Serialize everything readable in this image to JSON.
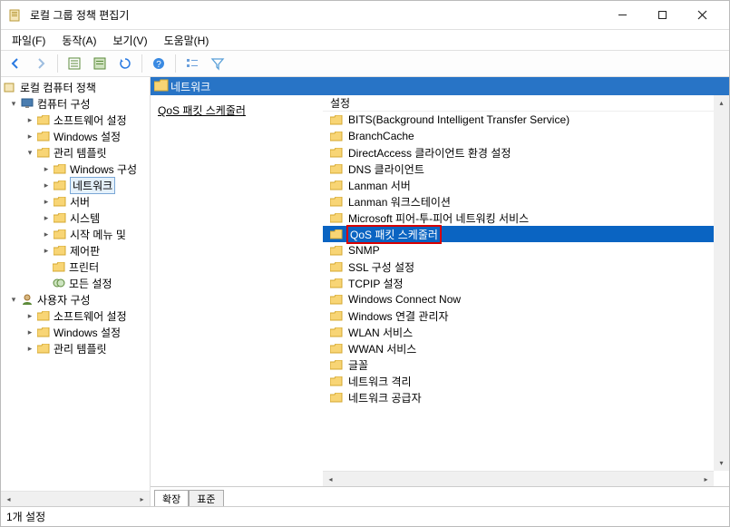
{
  "window": {
    "title": "로컬 그룹 정책 편집기"
  },
  "menu": {
    "file": "파일(F)",
    "action": "동작(A)",
    "view": "보기(V)",
    "help": "도움말(H)"
  },
  "toolbar_icons": {
    "back": "back-arrow",
    "forward": "forward-arrow",
    "properties": "properties",
    "details": "details",
    "refresh": "refresh",
    "help": "help",
    "views": "views",
    "filter": "filter"
  },
  "tree": {
    "root": "로컬 컴퓨터 정책",
    "computer": "컴퓨터 구성",
    "c_sw": "소프트웨어 설정",
    "c_win": "Windows 설정",
    "c_admin": "관리 템플릿",
    "c_admin_win": "Windows 구성",
    "c_admin_net": "네트워크",
    "c_admin_server": "서버",
    "c_admin_system": "시스템",
    "c_admin_start": "시작 메뉴 및",
    "c_admin_ctrl": "제어판",
    "c_admin_printer": "프린터",
    "c_admin_all": "모든 설정",
    "user": "사용자 구성",
    "u_sw": "소프트웨어 설정",
    "u_win": "Windows 설정",
    "u_admin": "관리 템플릿"
  },
  "header": {
    "title": "네트워크"
  },
  "detail": {
    "selection_name": "QoS 패킷 스케줄러"
  },
  "list": {
    "col_header": "설정",
    "items": [
      "BITS(Background Intelligent Transfer Service)",
      "BranchCache",
      "DirectAccess 클라이언트 환경 설정",
      "DNS 클라이언트",
      "Lanman 서버",
      "Lanman 워크스테이션",
      "Microsoft 피어-투-피어 네트워킹 서비스",
      "QoS 패킷 스케줄러",
      "SNMP",
      "SSL 구성 설정",
      "TCPIP 설정",
      "Windows Connect Now",
      "Windows 연결 관리자",
      "WLAN 서비스",
      "WWAN 서비스",
      "글꼴",
      "네트워크 격리",
      "네트워크 공급자"
    ],
    "selected_index": 7
  },
  "tabs": {
    "extended": "확장",
    "standard": "표준"
  },
  "status": {
    "text": "1개 설정"
  }
}
